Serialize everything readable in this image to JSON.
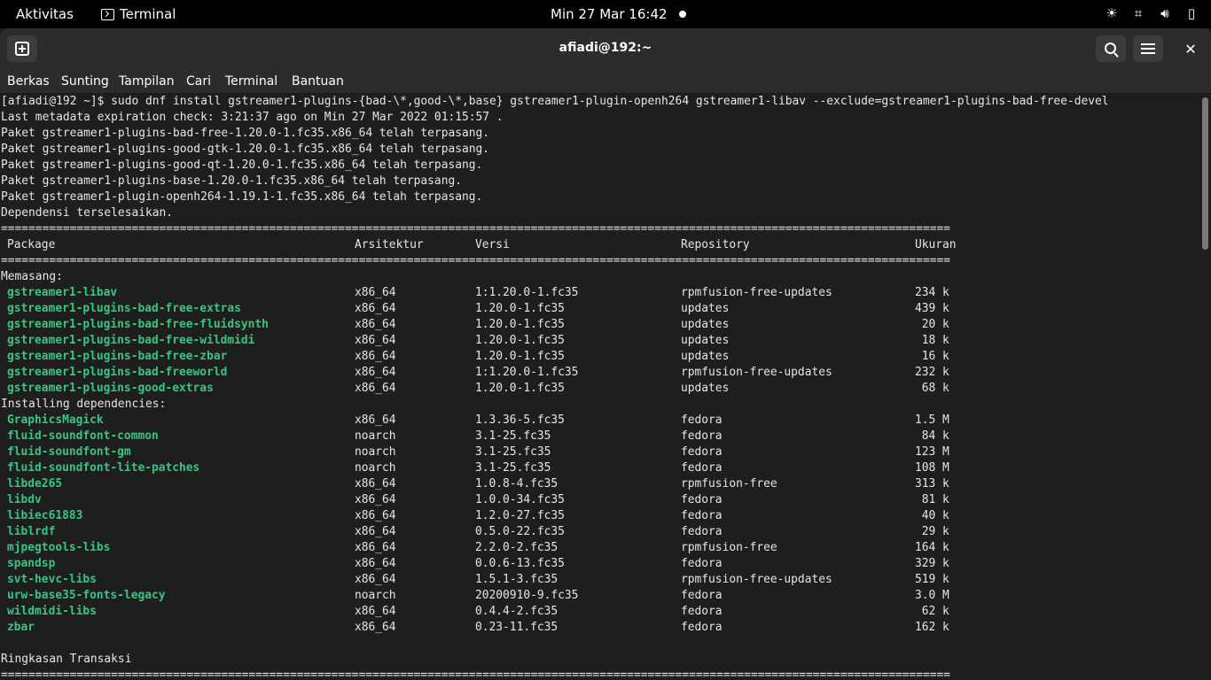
{
  "topbar": {
    "activities": "Aktivitas",
    "app_name": "Terminal",
    "clock": "Min 27 Mar  16:42"
  },
  "window": {
    "title": "afiadi@192:~",
    "menu": [
      "Berkas",
      "Sunting",
      "Tampilan",
      "Cari",
      "Terminal",
      "Bantuan"
    ]
  },
  "terminal": {
    "head_lines": [
      "[afiadi@192 ~]$ sudo dnf install gstreamer1-plugins-{bad-\\*,good-\\*,base} gstreamer1-plugin-openh264 gstreamer1-libav --exclude=gstreamer1-plugins-bad-free-devel",
      "Last metadata expiration check: 3:21:37 ago on Min 27 Mar 2022 01:15:57 .",
      "Paket gstreamer1-plugins-bad-free-1.20.0-1.fc35.x86_64 telah terpasang.",
      "Paket gstreamer1-plugins-good-gtk-1.20.0-1.fc35.x86_64 telah terpasang.",
      "Paket gstreamer1-plugins-good-qt-1.20.0-1.fc35.x86_64 telah terpasang.",
      "Paket gstreamer1-plugins-base-1.20.0-1.fc35.x86_64 telah terpasang.",
      "Paket gstreamer1-plugin-openh264-1.19.1-1.fc35.x86_64 telah terpasang.",
      "Dependensi terselesaikan."
    ],
    "rule": "==========================================================================================================================================",
    "columns": [
      "Package",
      "Arsitektur",
      "Versi",
      "Repository",
      "Ukuran"
    ],
    "installing_label": "Memasang:",
    "installing": [
      {
        "name": "gstreamer1-libav",
        "arch": "x86_64",
        "version": "1:1.20.0-1.fc35",
        "repo": "rpmfusion-free-updates",
        "size": "234 k"
      },
      {
        "name": "gstreamer1-plugins-bad-free-extras",
        "arch": "x86_64",
        "version": "1.20.0-1.fc35",
        "repo": "updates",
        "size": "439 k"
      },
      {
        "name": "gstreamer1-plugins-bad-free-fluidsynth",
        "arch": "x86_64",
        "version": "1.20.0-1.fc35",
        "repo": "updates",
        "size": " 20 k"
      },
      {
        "name": "gstreamer1-plugins-bad-free-wildmidi",
        "arch": "x86_64",
        "version": "1.20.0-1.fc35",
        "repo": "updates",
        "size": " 18 k"
      },
      {
        "name": "gstreamer1-plugins-bad-free-zbar",
        "arch": "x86_64",
        "version": "1.20.0-1.fc35",
        "repo": "updates",
        "size": " 16 k"
      },
      {
        "name": "gstreamer1-plugins-bad-freeworld",
        "arch": "x86_64",
        "version": "1:1.20.0-1.fc35",
        "repo": "rpmfusion-free-updates",
        "size": "232 k"
      },
      {
        "name": "gstreamer1-plugins-good-extras",
        "arch": "x86_64",
        "version": "1.20.0-1.fc35",
        "repo": "updates",
        "size": " 68 k"
      }
    ],
    "deps_label": "Installing dependencies:",
    "dependencies": [
      {
        "name": "GraphicsMagick",
        "arch": "x86_64",
        "version": "1.3.36-5.fc35",
        "repo": "fedora",
        "size": "1.5 M"
      },
      {
        "name": "fluid-soundfont-common",
        "arch": "noarch",
        "version": "3.1-25.fc35",
        "repo": "fedora",
        "size": " 84 k"
      },
      {
        "name": "fluid-soundfont-gm",
        "arch": "noarch",
        "version": "3.1-25.fc35",
        "repo": "fedora",
        "size": "123 M"
      },
      {
        "name": "fluid-soundfont-lite-patches",
        "arch": "noarch",
        "version": "3.1-25.fc35",
        "repo": "fedora",
        "size": "108 M"
      },
      {
        "name": "libde265",
        "arch": "x86_64",
        "version": "1.0.8-4.fc35",
        "repo": "rpmfusion-free",
        "size": "313 k"
      },
      {
        "name": "libdv",
        "arch": "x86_64",
        "version": "1.0.0-34.fc35",
        "repo": "fedora",
        "size": " 81 k"
      },
      {
        "name": "libiec61883",
        "arch": "x86_64",
        "version": "1.2.0-27.fc35",
        "repo": "fedora",
        "size": " 40 k"
      },
      {
        "name": "liblrdf",
        "arch": "x86_64",
        "version": "0.5.0-22.fc35",
        "repo": "fedora",
        "size": " 29 k"
      },
      {
        "name": "mjpegtools-libs",
        "arch": "x86_64",
        "version": "2.2.0-2.fc35",
        "repo": "rpmfusion-free",
        "size": "164 k"
      },
      {
        "name": "spandsp",
        "arch": "x86_64",
        "version": "0.0.6-13.fc35",
        "repo": "fedora",
        "size": "329 k"
      },
      {
        "name": "svt-hevc-libs",
        "arch": "x86_64",
        "version": "1.5.1-3.fc35",
        "repo": "rpmfusion-free-updates",
        "size": "519 k"
      },
      {
        "name": "urw-base35-fonts-legacy",
        "arch": "noarch",
        "version": "20200910-9.fc35",
        "repo": "fedora",
        "size": "3.0 M"
      },
      {
        "name": "wildmidi-libs",
        "arch": "x86_64",
        "version": "0.4.4-2.fc35",
        "repo": "fedora",
        "size": " 62 k"
      },
      {
        "name": "zbar",
        "arch": "x86_64",
        "version": "0.23-11.fc35",
        "repo": "fedora",
        "size": "162 k"
      }
    ],
    "summary_label": "Ringkasan Transaksi"
  }
}
